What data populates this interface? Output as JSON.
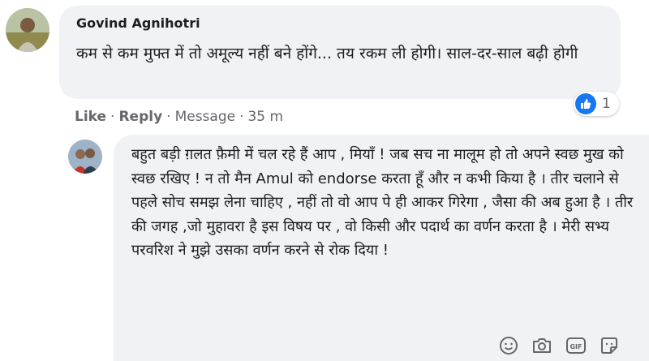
{
  "comment": {
    "author": "Govind Agnihotri",
    "text": "कम से कम मुफ्त में तो अमूल्य नहीं बने होंगे... तय रकम ली होगी। साल-दर-साल बढ़ी होगी",
    "avatar_icon": "profile-photo",
    "actions": {
      "like": "Like",
      "dot1": "·",
      "reply": "Reply",
      "dot2": "·",
      "message": "Message",
      "dot3": "·",
      "time": "35 m"
    },
    "reaction": {
      "icon": "like-icon",
      "count": "1",
      "color": "#1877f2"
    }
  },
  "reply_draft": {
    "avatar_icon": "profile-photo",
    "text": "बहुत बड़ी ग़लत फ़ैमी में चल रहे हैं आप , मियाँ ! जब सच ना मालूम हो तो अपने स्वछ मुख को स्वछ रखिए ! न तो मैन Amul को endorse करता हूँ और न कभी किया है । तीर चलाने से पहले सोच समझ लेना चाहिए , नहीं तो वो आप पे ही आकर गिरेगा , जैसा की अब हुआ है । तीर की जगह ,जो मुहावरा है इस विषय पर , वो किसी और पदार्थ का वर्णन करता है । मेरी सभ्य परवरिश ने मुझे उसका वर्णन करने से रोक दिया !",
    "toolbar_icons": [
      "emoji-icon",
      "camera-icon",
      "gif-icon",
      "sticker-icon"
    ],
    "gif_label": "GIF"
  },
  "colors": {
    "bubble_bg": "#f0f2f5",
    "meta_text": "#65676b",
    "primary_text": "#1c1e21"
  }
}
